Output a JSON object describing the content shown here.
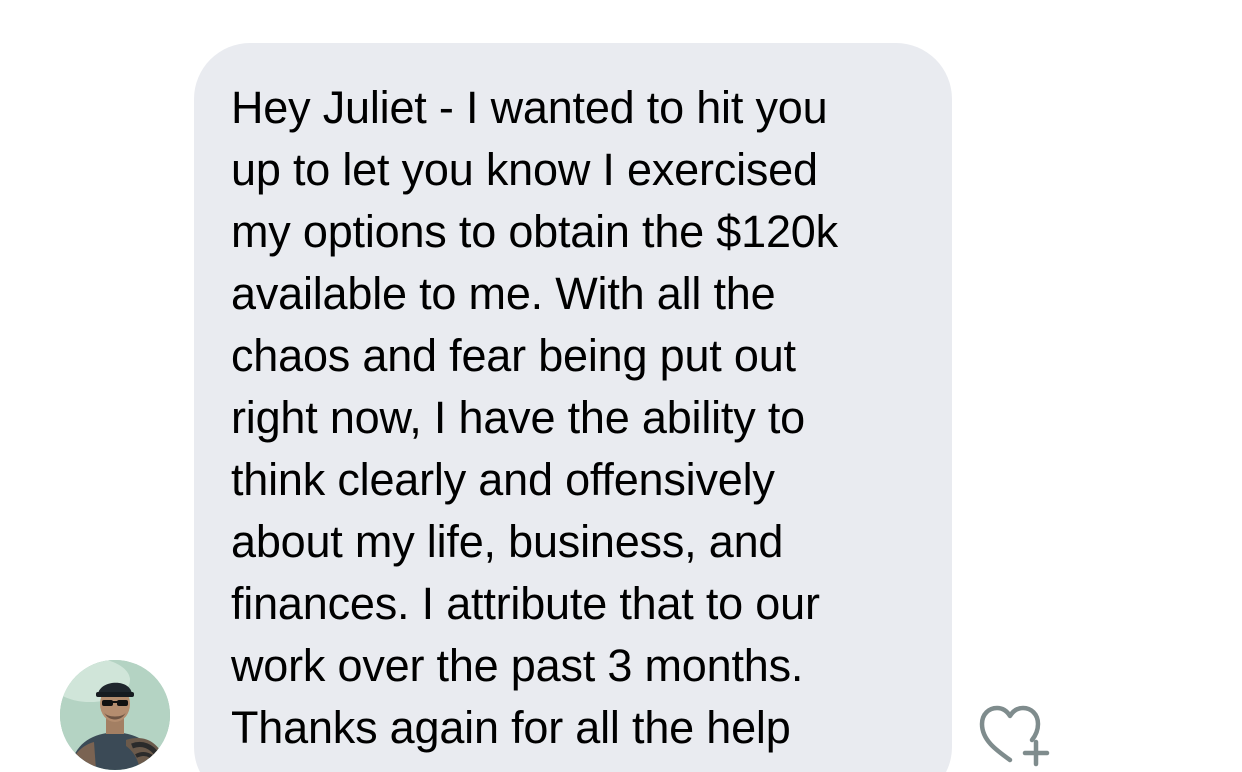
{
  "message": {
    "lines": [
      "Hey Juliet - I wanted to hit you",
      "up to let you know I exercised",
      "my options to obtain the $120k",
      "available to me. With all the",
      "chaos and fear being put out",
      "right now, I have the ability to",
      "think clearly and offensively",
      "about my life, business, and",
      "finances. I attribute that to our",
      "work over the past 3 months.",
      "Thanks again for all the help"
    ]
  },
  "avatar": {
    "icon": "user-avatar"
  },
  "reaction": {
    "icon": "heart-plus-icon"
  },
  "colors": {
    "bubble_bg": "#e9ebf0",
    "text": "#000000",
    "reaction_icon": "#7f8c8d"
  }
}
